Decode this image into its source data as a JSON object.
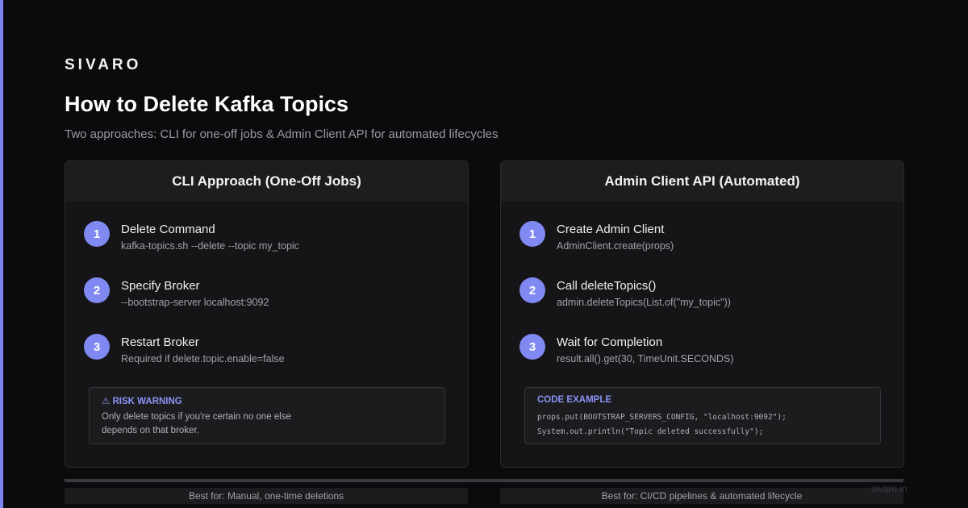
{
  "brand": "SIVARO",
  "title": "How to Delete Kafka Topics",
  "subtitle": "Two approaches: CLI for one-off jobs & Admin Client API for automated lifecycles",
  "colors": {
    "accent": "#8089f2",
    "background": "#0b0b0d",
    "card": "#151517"
  },
  "left_card": {
    "header": "CLI Approach (One-Off Jobs)",
    "steps": [
      {
        "num": "1",
        "title": "Delete Command",
        "desc": "kafka-topics.sh --delete --topic my_topic"
      },
      {
        "num": "2",
        "title": "Specify Broker",
        "desc": "--bootstrap-server localhost:9092"
      },
      {
        "num": "3",
        "title": "Restart Broker",
        "desc": "Required if delete.topic.enable=false"
      }
    ],
    "box": {
      "icon": "warning-icon",
      "label": "⚠ RISK WARNING",
      "text": "Only delete topics if you're certain no one else depends on that broker."
    }
  },
  "right_card": {
    "header": "Admin Client API (Automated)",
    "steps": [
      {
        "num": "1",
        "title": "Create Admin Client",
        "desc": "AdminClient.create(props)"
      },
      {
        "num": "2",
        "title": "Call deleteTopics()",
        "desc": "admin.deleteTopics(List.of(\"my_topic\"))"
      },
      {
        "num": "3",
        "title": "Wait for Completion",
        "desc": "result.all().get(30, TimeUnit.SECONDS)"
      }
    ],
    "box": {
      "label": "CODE EXAMPLE",
      "code": [
        "props.put(BOOTSTRAP_SERVERS_CONFIG, \"localhost:9092\");",
        "System.out.println(\"Topic deleted successfully\");"
      ]
    }
  },
  "footer": {
    "left": "Best for: Manual, one-time deletions",
    "right": "Best for: CI/CD pipelines & automated lifecycle"
  },
  "watermark": "sivaro.in"
}
